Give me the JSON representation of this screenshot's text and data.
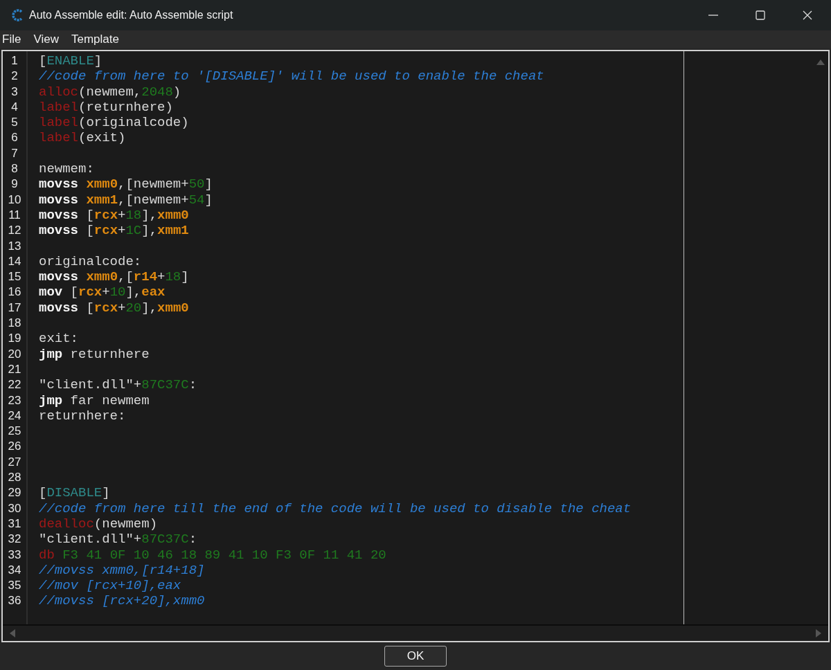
{
  "window": {
    "title": "Auto Assemble edit: Auto Assemble script"
  },
  "menu": [
    {
      "label": "File"
    },
    {
      "label": "View"
    },
    {
      "label": "Template"
    }
  ],
  "editor": {
    "lines": [
      {
        "number": "1",
        "tokens": [
          {
            "text": "[",
            "kind": "plain"
          },
          {
            "text": "ENABLE",
            "kind": "section"
          },
          {
            "text": "]",
            "kind": "plain"
          }
        ]
      },
      {
        "number": "2",
        "tokens": [
          {
            "text": "//code from here to '[DISABLE]' will be used to enable the cheat",
            "kind": "comment"
          }
        ]
      },
      {
        "number": "3",
        "tokens": [
          {
            "text": "alloc",
            "kind": "keyword"
          },
          {
            "text": "(newmem,",
            "kind": "plain"
          },
          {
            "text": "2048",
            "kind": "number"
          },
          {
            "text": ")",
            "kind": "plain"
          }
        ]
      },
      {
        "number": "4",
        "tokens": [
          {
            "text": "label",
            "kind": "keyword"
          },
          {
            "text": "(returnhere)",
            "kind": "plain"
          }
        ]
      },
      {
        "number": "5",
        "tokens": [
          {
            "text": "label",
            "kind": "keyword"
          },
          {
            "text": "(originalcode)",
            "kind": "plain"
          }
        ]
      },
      {
        "number": "6",
        "tokens": [
          {
            "text": "label",
            "kind": "keyword"
          },
          {
            "text": "(exit)",
            "kind": "plain"
          }
        ]
      },
      {
        "number": "7"
      },
      {
        "number": "8",
        "tokens": [
          {
            "text": "newmem:",
            "kind": "plain"
          }
        ]
      },
      {
        "number": "9",
        "tokens": [
          {
            "text": "movss ",
            "kind": "instruction"
          },
          {
            "text": "xmm0",
            "kind": "register"
          },
          {
            "text": ",[newmem+",
            "kind": "plain"
          },
          {
            "text": "50",
            "kind": "number"
          },
          {
            "text": "]",
            "kind": "plain"
          }
        ]
      },
      {
        "number": "10",
        "tokens": [
          {
            "text": "movss ",
            "kind": "instruction"
          },
          {
            "text": "xmm1",
            "kind": "register"
          },
          {
            "text": ",[newmem+",
            "kind": "plain"
          },
          {
            "text": "54",
            "kind": "number"
          },
          {
            "text": "]",
            "kind": "plain"
          }
        ]
      },
      {
        "number": "11",
        "tokens": [
          {
            "text": "movss ",
            "kind": "instruction"
          },
          {
            "text": "[",
            "kind": "plain"
          },
          {
            "text": "rcx",
            "kind": "register"
          },
          {
            "text": "+",
            "kind": "plain"
          },
          {
            "text": "18",
            "kind": "number"
          },
          {
            "text": "],",
            "kind": "plain"
          },
          {
            "text": "xmm0",
            "kind": "register"
          }
        ]
      },
      {
        "number": "12",
        "tokens": [
          {
            "text": "movss ",
            "kind": "instruction"
          },
          {
            "text": "[",
            "kind": "plain"
          },
          {
            "text": "rcx",
            "kind": "register"
          },
          {
            "text": "+",
            "kind": "plain"
          },
          {
            "text": "1C",
            "kind": "number"
          },
          {
            "text": "],",
            "kind": "plain"
          },
          {
            "text": "xmm1",
            "kind": "register"
          }
        ]
      },
      {
        "number": "13"
      },
      {
        "number": "14",
        "tokens": [
          {
            "text": "originalcode:",
            "kind": "plain"
          }
        ]
      },
      {
        "number": "15",
        "tokens": [
          {
            "text": "movss ",
            "kind": "instruction"
          },
          {
            "text": "xmm0",
            "kind": "register"
          },
          {
            "text": ",[",
            "kind": "plain"
          },
          {
            "text": "r14",
            "kind": "register"
          },
          {
            "text": "+",
            "kind": "plain"
          },
          {
            "text": "18",
            "kind": "number"
          },
          {
            "text": "]",
            "kind": "plain"
          }
        ]
      },
      {
        "number": "16",
        "tokens": [
          {
            "text": "mov ",
            "kind": "instruction"
          },
          {
            "text": "[",
            "kind": "plain"
          },
          {
            "text": "rcx",
            "kind": "register"
          },
          {
            "text": "+",
            "kind": "plain"
          },
          {
            "text": "10",
            "kind": "number"
          },
          {
            "text": "],",
            "kind": "plain"
          },
          {
            "text": "eax",
            "kind": "register"
          }
        ]
      },
      {
        "number": "17",
        "tokens": [
          {
            "text": "movss ",
            "kind": "instruction"
          },
          {
            "text": "[",
            "kind": "plain"
          },
          {
            "text": "rcx",
            "kind": "register"
          },
          {
            "text": "+",
            "kind": "plain"
          },
          {
            "text": "20",
            "kind": "number"
          },
          {
            "text": "],",
            "kind": "plain"
          },
          {
            "text": "xmm0",
            "kind": "register"
          }
        ]
      },
      {
        "number": "18"
      },
      {
        "number": "19",
        "tokens": [
          {
            "text": "exit:",
            "kind": "plain"
          }
        ]
      },
      {
        "number": "20",
        "tokens": [
          {
            "text": "jmp ",
            "kind": "instruction"
          },
          {
            "text": "returnhere",
            "kind": "plain"
          }
        ]
      },
      {
        "number": "21"
      },
      {
        "number": "22",
        "tokens": [
          {
            "text": "\"client.dll\"+",
            "kind": "plain"
          },
          {
            "text": "87C37C",
            "kind": "number"
          },
          {
            "text": ":",
            "kind": "plain"
          }
        ]
      },
      {
        "number": "23",
        "tokens": [
          {
            "text": "jmp ",
            "kind": "instruction"
          },
          {
            "text": "far newmem",
            "kind": "plain"
          }
        ]
      },
      {
        "number": "24",
        "tokens": [
          {
            "text": "returnhere:",
            "kind": "plain"
          }
        ]
      },
      {
        "number": "25"
      },
      {
        "number": "26"
      },
      {
        "number": "27"
      },
      {
        "number": "28"
      },
      {
        "number": "29",
        "tokens": [
          {
            "text": "[",
            "kind": "plain"
          },
          {
            "text": "DISABLE",
            "kind": "section"
          },
          {
            "text": "]",
            "kind": "plain"
          }
        ]
      },
      {
        "number": "30",
        "tokens": [
          {
            "text": "//code from here till the end of the code will be used to disable the cheat",
            "kind": "comment"
          }
        ]
      },
      {
        "number": "31",
        "tokens": [
          {
            "text": "dealloc",
            "kind": "keyword"
          },
          {
            "text": "(newmem)",
            "kind": "plain"
          }
        ]
      },
      {
        "number": "32",
        "tokens": [
          {
            "text": "\"client.dll\"+",
            "kind": "plain"
          },
          {
            "text": "87C37C",
            "kind": "number"
          },
          {
            "text": ":",
            "kind": "plain"
          }
        ]
      },
      {
        "number": "33",
        "tokens": [
          {
            "text": "db",
            "kind": "keyword"
          },
          {
            "text": " F3 41 0F 10 46 18 89 41 10 F3 0F 11 41 20",
            "kind": "number"
          }
        ]
      },
      {
        "number": "34",
        "tokens": [
          {
            "text": "//movss xmm0,[r14+18]",
            "kind": "comment"
          }
        ]
      },
      {
        "number": "35",
        "tokens": [
          {
            "text": "//mov [rcx+10],eax",
            "kind": "comment"
          }
        ]
      },
      {
        "number": "36",
        "tokens": [
          {
            "text": "//movss [rcx+20],xmm0",
            "kind": "comment"
          }
        ]
      }
    ]
  },
  "buttons": [
    {
      "label": "OK"
    }
  ]
}
